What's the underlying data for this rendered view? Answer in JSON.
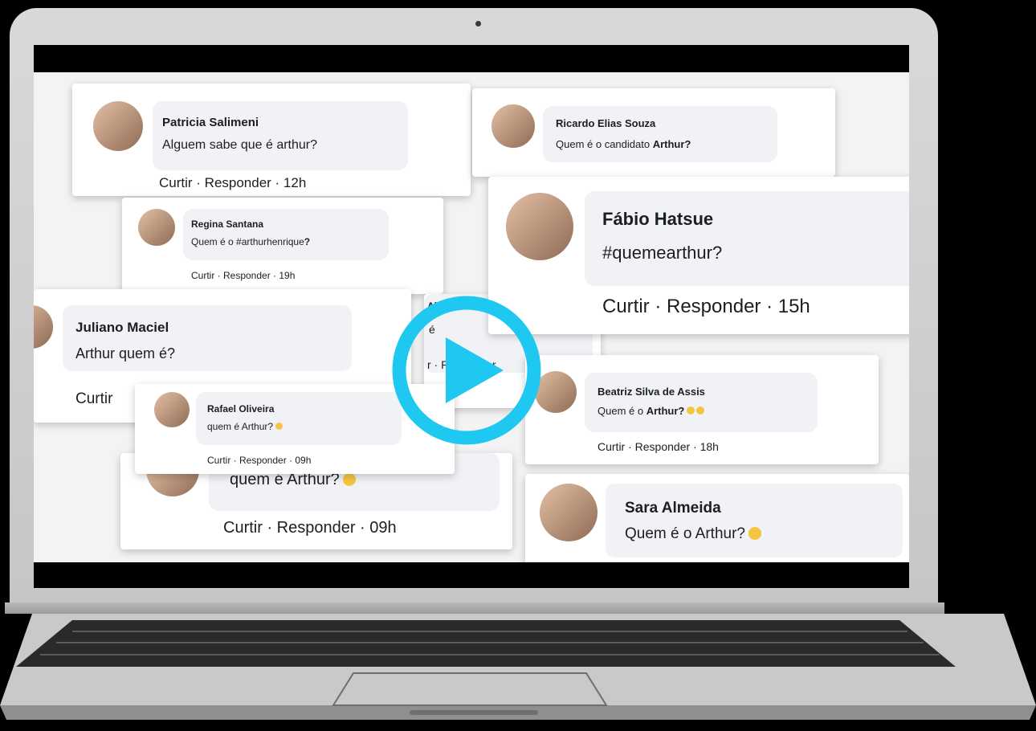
{
  "comments": [
    {
      "id": "patricia",
      "name": "Patricia Salimeni",
      "text": "Alguem sabe que é arthur?",
      "actions": "Curtir · Responder · 12h"
    },
    {
      "id": "ricardo",
      "name": "Ricardo Elias Souza",
      "text_prefix": "Quem é o candidato ",
      "text_bold": "Arthur?"
    },
    {
      "id": "regina",
      "name": "Regina Santana",
      "text_prefix": "Quem é o #arthurhenrique",
      "text_bold": "?",
      "actions": "Curtir · Responder · 19h"
    },
    {
      "id": "fabio",
      "name": "Fábio Hatsue",
      "text": "#quemearthur?",
      "actions": "Curtir · Responder · 15h"
    },
    {
      "id": "juliano",
      "name": "Juliano Maciel",
      "text": "Arthur quem é?",
      "actions": "Curtir"
    },
    {
      "id": "rafael",
      "name": "Rafael Oliveira",
      "text": "quem é Arthur?",
      "actions": "Curtir · Responder · 09h"
    },
    {
      "id": "rafael_large",
      "text": "quem é Arthur?",
      "actions": "Curtir · Responder · 09h"
    },
    {
      "id": "almeida_partial",
      "name_partial": "Almeida",
      "text_partial": "é",
      "actions_partial": "r · Responder"
    },
    {
      "id": "beatriz",
      "name": "Beatriz Silva de Assis",
      "text_prefix": "Quem é o ",
      "text_bold": "Arthur?",
      "actions": "Curtir · Responder · 18h"
    },
    {
      "id": "sara",
      "name": "Sara Almeida",
      "text": "Quem é o Arthur?"
    }
  ],
  "colors": {
    "play_button": "#1ec8f0",
    "bubble": "#f0f2f5",
    "emoji": "#f5c542"
  },
  "icons": {
    "play": "play-icon",
    "camera": "camera-icon"
  }
}
